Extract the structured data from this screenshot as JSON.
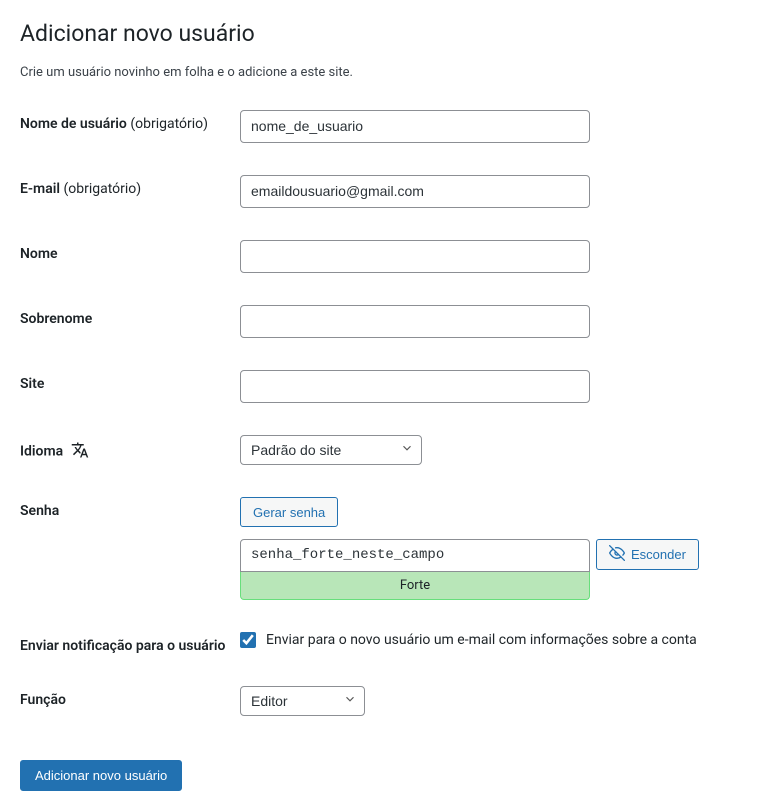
{
  "page": {
    "title": "Adicionar novo usuário",
    "description": "Crie um usuário novinho em folha e o adicione a este site."
  },
  "labels": {
    "username": "Nome de usuário",
    "username_required": "(obrigatório)",
    "email": "E-mail",
    "email_required": "(obrigatório)",
    "first_name": "Nome",
    "last_name": "Sobrenome",
    "website": "Site",
    "language": "Idioma",
    "password": "Senha",
    "send_notification": "Enviar notificação para o usuário",
    "role": "Função"
  },
  "values": {
    "username": "nome_de_usuario",
    "email": "emaildousuario@gmail.com",
    "first_name": "",
    "last_name": "",
    "website": "",
    "language": "Padrão do site",
    "password": "senha_forte_neste_campo",
    "role": "Editor"
  },
  "buttons": {
    "generate_password": "Gerar senha",
    "hide_password": "Esconder",
    "submit": "Adicionar novo usuário"
  },
  "password_strength": "Forte",
  "notification": {
    "checkbox_label": "Enviar para o novo usuário um e-mail com informações sobre a conta",
    "checked": true
  },
  "icons": {
    "translate": "translate-icon",
    "chevron_down": "chevron-down-icon",
    "eye_slash": "eye-slash-icon"
  }
}
